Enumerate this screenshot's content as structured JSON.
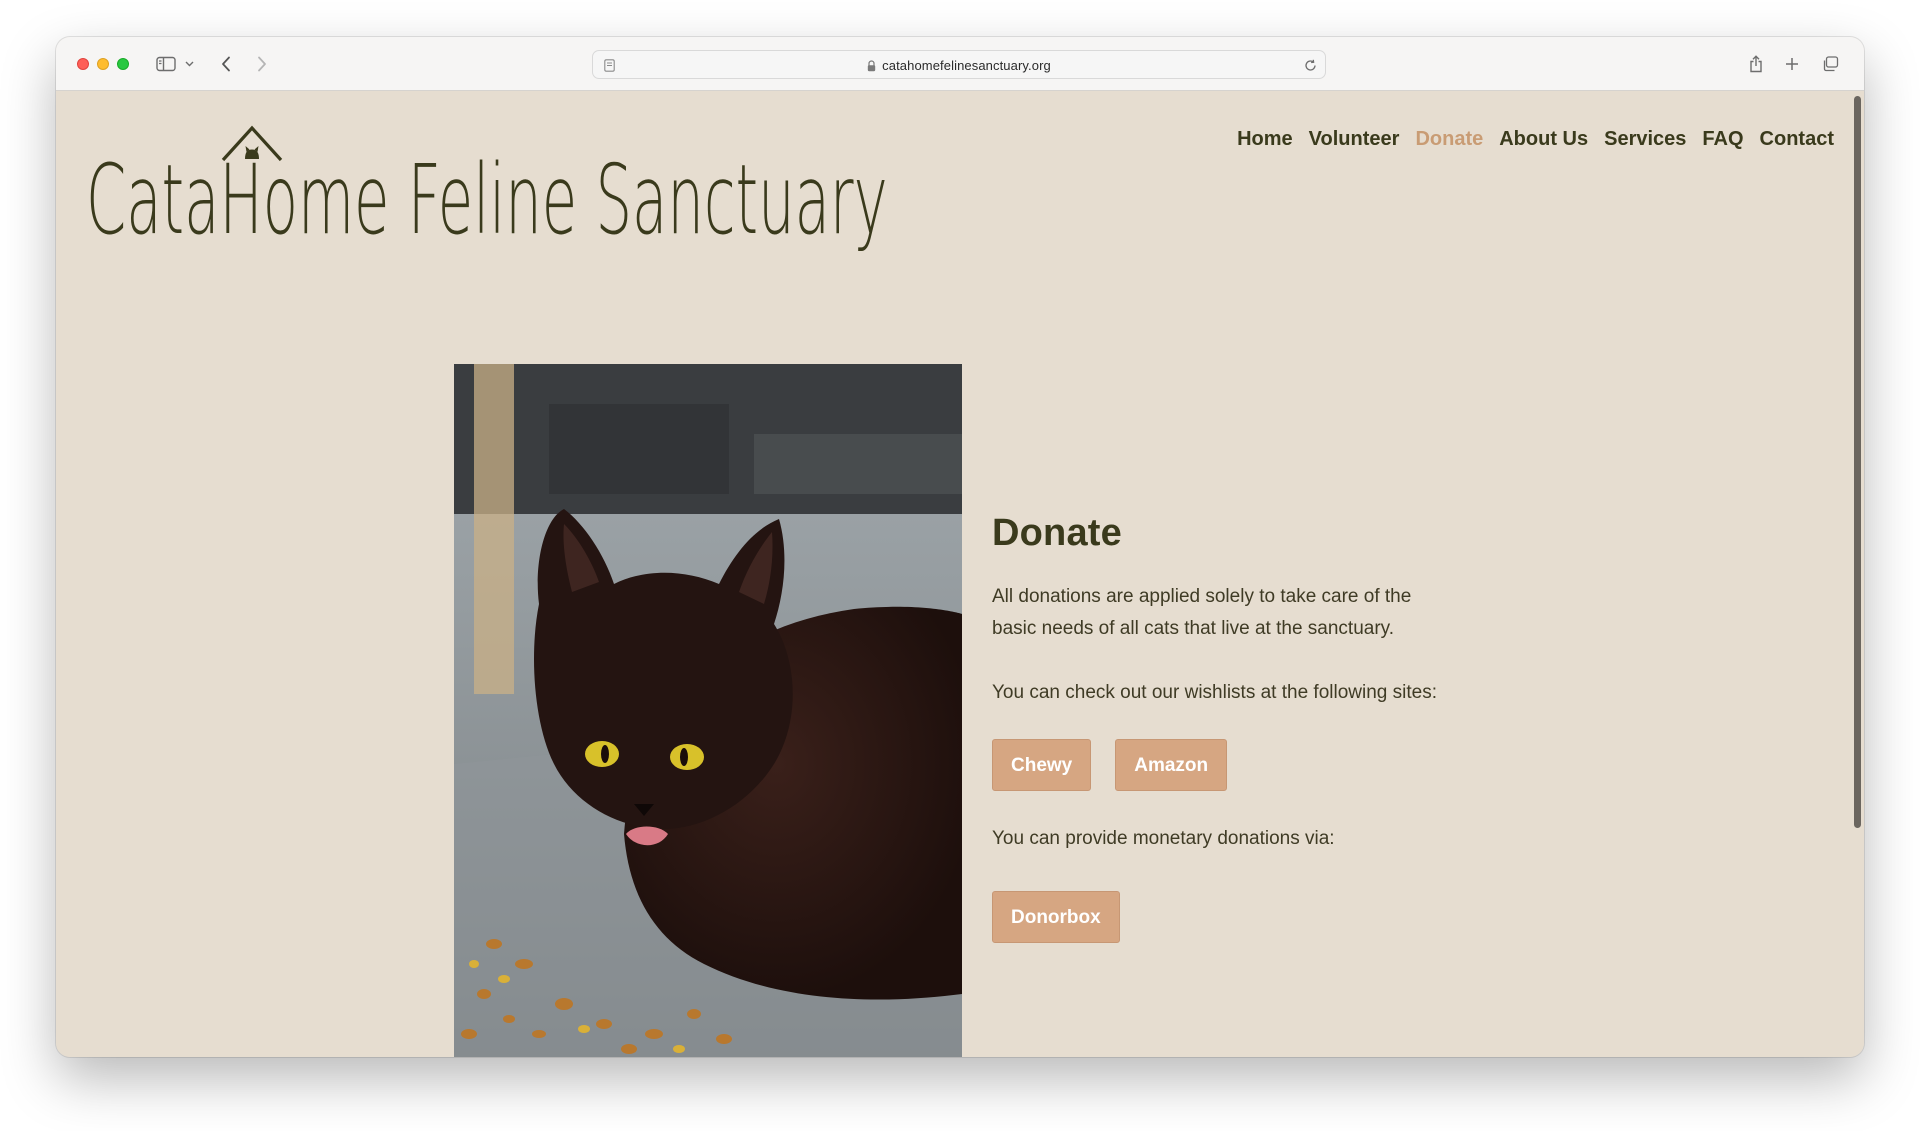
{
  "browser": {
    "url": "catahomefelinesanctuary.org",
    "icons": {
      "sidebar": "sidebar-icon",
      "chevron": "chevron-down-icon",
      "back": "back-arrow-icon",
      "forward": "forward-arrow-icon",
      "reader": "reader-icon",
      "lock": "lock-icon",
      "reload": "reload-icon",
      "share": "share-icon",
      "new_tab": "plus-icon",
      "tabs": "tabs-overview-icon"
    },
    "traffic_colors": [
      "#fe5f57",
      "#febc2e",
      "#28c840"
    ]
  },
  "site": {
    "logo_text": "CataHome Feline Sanctuary",
    "nav": [
      {
        "label": "Home",
        "active": false
      },
      {
        "label": "Volunteer",
        "active": false
      },
      {
        "label": "Donate",
        "active": true
      },
      {
        "label": "About Us",
        "active": false
      },
      {
        "label": "Services",
        "active": false
      },
      {
        "label": "FAQ",
        "active": false
      },
      {
        "label": "Contact",
        "active": false
      }
    ],
    "colors": {
      "background": "#e6ddd0",
      "text": "#3a3a1c",
      "active_nav": "#c99c74",
      "button": "#d6a682"
    }
  },
  "main": {
    "image_alt": "",
    "heading": "Donate",
    "paragraph1": "All donations are applied solely to take care of the basic needs of all cats that live at the sanctuary.",
    "paragraph2": "You can check out our wishlists at the following sites:",
    "wishlist_buttons": [
      "Chewy",
      "Amazon"
    ],
    "paragraph3": "You can provide monetary donations via:",
    "donation_buttons": [
      "Donorbox"
    ]
  }
}
